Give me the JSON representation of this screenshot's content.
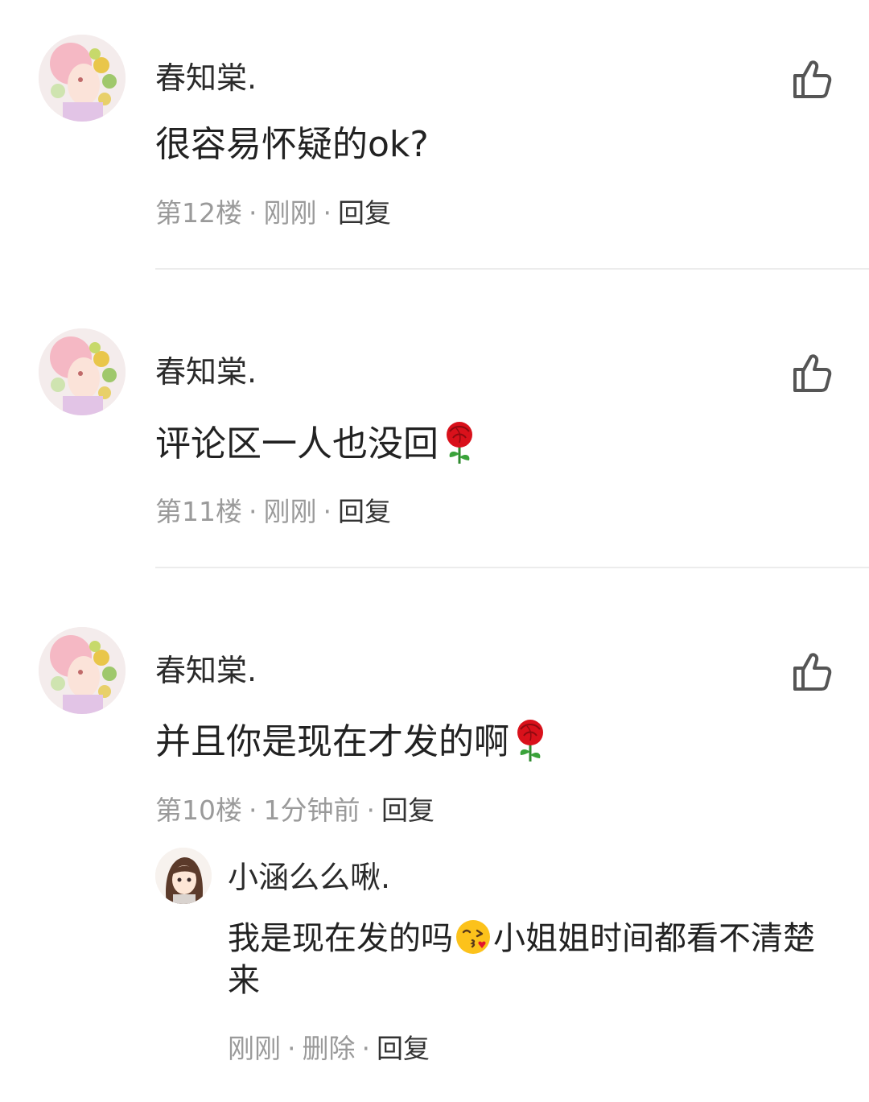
{
  "comments": [
    {
      "username": "春知棠.",
      "text": "很容易怀疑的ok?",
      "floor": "第12楼",
      "time": "刚刚",
      "reply": "回复",
      "emoji": "",
      "avatar_icon": "illustrated-girl-avatar",
      "like_icon": "thumbs-up-icon"
    },
    {
      "username": "春知棠.",
      "text": "评论区一人也没回",
      "floor": "第11楼",
      "time": "刚刚",
      "reply": "回复",
      "emoji": "rose",
      "avatar_icon": "illustrated-girl-avatar",
      "like_icon": "thumbs-up-icon"
    },
    {
      "username": "春知棠.",
      "text": "并且你是现在才发的啊",
      "floor": "第10楼",
      "time": "1分钟前",
      "reply": "回复",
      "emoji": "rose",
      "avatar_icon": "illustrated-girl-avatar",
      "like_icon": "thumbs-up-icon",
      "sub_reply": {
        "username": "小涵么么啾.",
        "text_before_emoji": "我是现在发的吗",
        "emoji": "kissing-face",
        "text_after_emoji": "小姐姐时间都看不清楚来",
        "time": "刚刚",
        "delete": "删除",
        "reply": "回复",
        "avatar_icon": "anime-girl-avatar"
      }
    }
  ],
  "colors": {
    "text": "#222222",
    "meta": "#9a9a9a",
    "divider": "#ececec",
    "rose": "#d9111b"
  }
}
